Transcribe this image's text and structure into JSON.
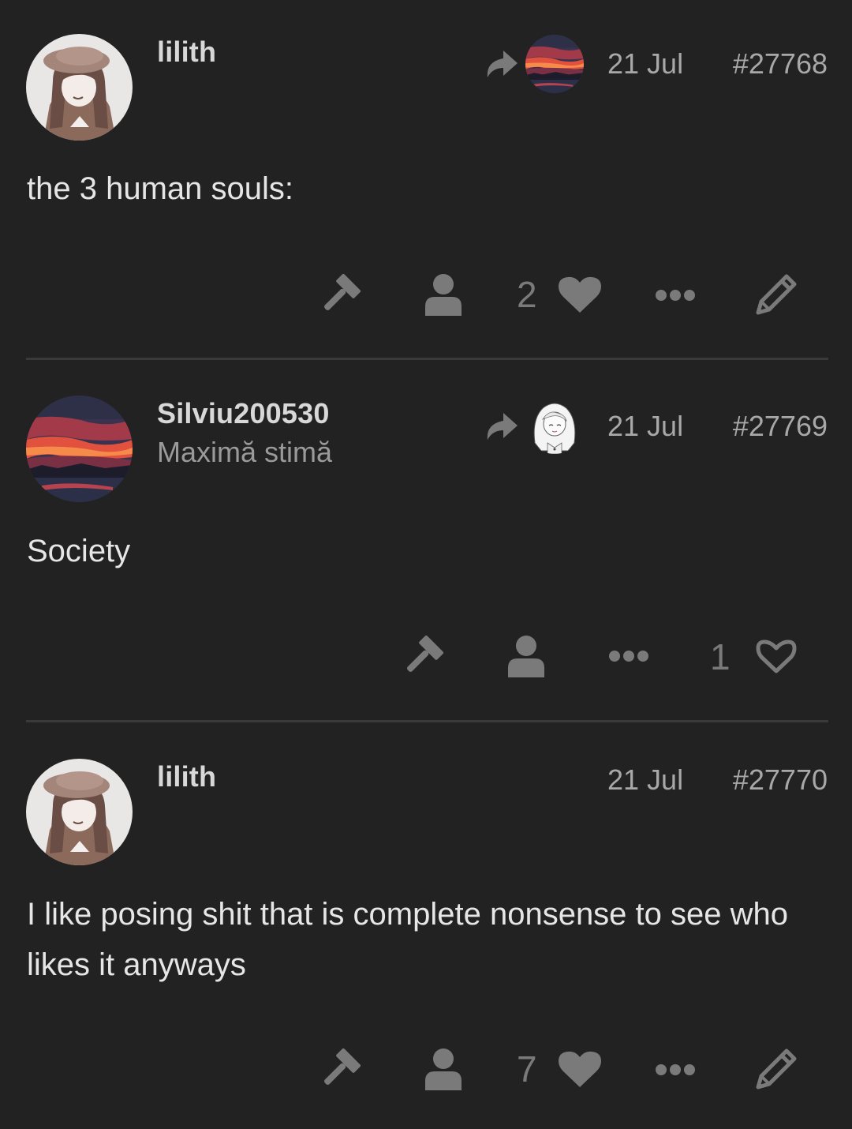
{
  "posts": [
    {
      "username": "lilith",
      "user_title": "",
      "date": "21 Jul",
      "post_number": "#27768",
      "body": "the 3 human souls:",
      "likes": "2",
      "avatar": "anime-girl-avatar",
      "reply_to_avatar": "sunset-avatar"
    },
    {
      "username": "Silviu200530",
      "user_title": "Maximă stimă",
      "date": "21 Jul",
      "post_number": "#27769",
      "body": "Society",
      "likes": "1",
      "avatar": "sunset-avatar",
      "reply_to_avatar": "white-hair-girl-avatar"
    },
    {
      "username": "lilith",
      "user_title": "",
      "date": "21 Jul",
      "post_number": "#27770",
      "body": "I like posing shit that is complete nonsense to see who likes it anyways",
      "likes": "7",
      "avatar": "anime-girl-avatar",
      "reply_to_avatar": ""
    }
  ],
  "colors": {
    "background": "#222222",
    "text": "#e6e6e6",
    "muted": "#a8a8a8",
    "icon": "#7a7a7a",
    "divider": "#3a3a3a"
  }
}
